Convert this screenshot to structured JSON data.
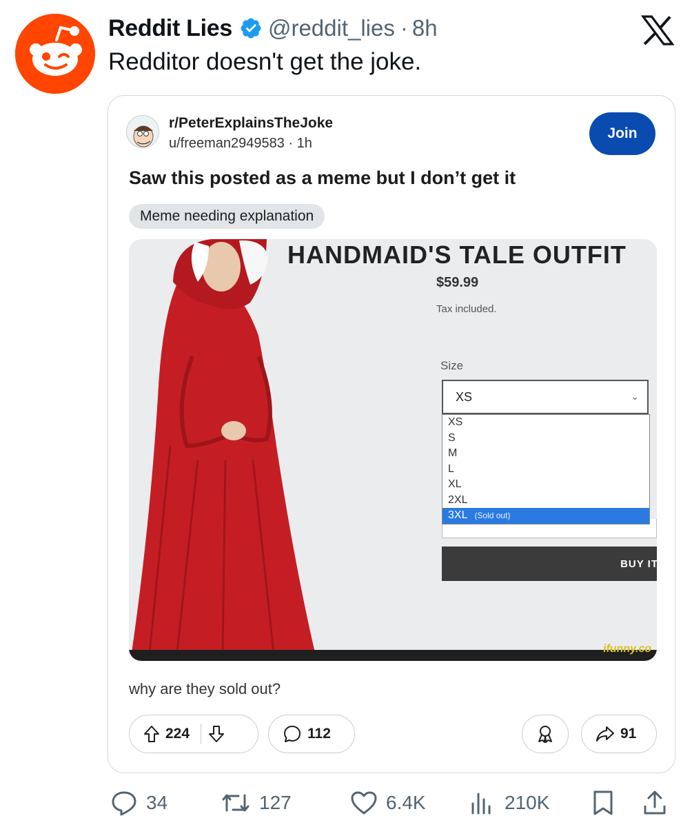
{
  "tweet": {
    "display_name": "Reddit Lies",
    "handle": "@reddit_lies",
    "separator": "·",
    "time": "8h",
    "text": "Redditor doesn't get the joke.",
    "colors": {
      "avatar": "#ff4500",
      "verified": "#1d9bf0",
      "secondary_text": "#536471"
    },
    "actions": {
      "replies": "34",
      "retweets": "127",
      "likes": "6.4K",
      "views": "210K"
    }
  },
  "reddit_post": {
    "subreddit": "r/PeterExplainsTheJoke",
    "meta": "u/freeman2949583 · 1h",
    "join_label": "Join",
    "title": "Saw this posted as a meme but I don’t get it",
    "flair": "Meme needing explanation",
    "caption": "why are they sold out?",
    "upvotes": "224",
    "comments": "112",
    "shares": "91",
    "colors": {
      "join": "#0a4bb0",
      "flair_bg": "#e2e5e8"
    }
  },
  "meme_image": {
    "product_title": "HANDMAID'S TALE OUTFIT",
    "price": "$59.99",
    "tax_note": "Tax included.",
    "size_label": "Size",
    "selected_size": "XS",
    "size_options": [
      "XS",
      "S",
      "M",
      "L",
      "XL",
      "2XL"
    ],
    "highlighted_option": "3XL",
    "highlighted_note": "(Sold out)",
    "buy_label": "BUY IT",
    "watermark": "ifunny.co",
    "colors": {
      "robe": "#c41e24",
      "highlight": "#2a7ae2",
      "buy_button": "#3b3b3b"
    }
  },
  "icons": [
    "reddit-logo-icon",
    "verified-badge-icon",
    "x-logo-icon",
    "upvote-icon",
    "downvote-icon",
    "comment-bubble-icon",
    "award-icon",
    "share-arrow-icon",
    "reply-icon",
    "retweet-icon",
    "like-icon",
    "views-icon",
    "bookmark-icon",
    "share-icon"
  ]
}
